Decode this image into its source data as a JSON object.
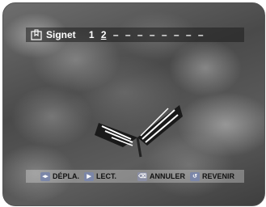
{
  "bookmark": {
    "title": "Signet",
    "icon": "bookmark-icon",
    "slots": [
      "1",
      "2",
      "–",
      "–",
      "–",
      "–",
      "–",
      "–",
      "–",
      "–"
    ],
    "active_slot": "2"
  },
  "help": {
    "move_label": "DÉPLA.",
    "play_label": "LECT.",
    "clear_label": "ANNULER",
    "return_label": "REVENIR",
    "move_icon": "move-arrows-icon",
    "play_icon": "play-icon",
    "clear_icon": "clear-icon",
    "return_icon": "return-icon"
  }
}
